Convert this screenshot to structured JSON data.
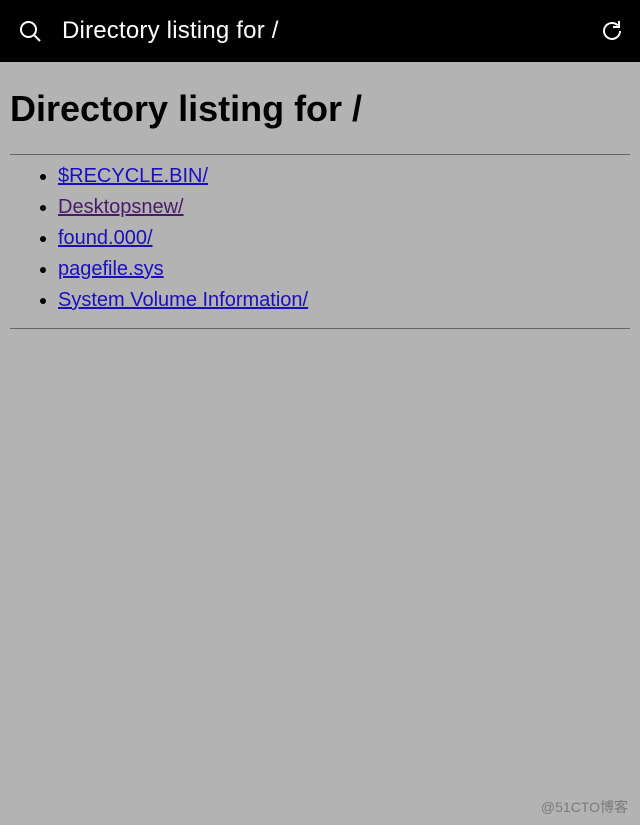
{
  "topbar": {
    "title": "Directory listing for /"
  },
  "page": {
    "heading": "Directory listing for /"
  },
  "listing": {
    "items": [
      {
        "label": "$RECYCLE.BIN/",
        "visited": false
      },
      {
        "label": "Desktopsnew/",
        "visited": true
      },
      {
        "label": "found.000/",
        "visited": false
      },
      {
        "label": "pagefile.sys",
        "visited": false
      },
      {
        "label": "System Volume Information/",
        "visited": false
      }
    ]
  },
  "watermark": "@51CTO博客"
}
